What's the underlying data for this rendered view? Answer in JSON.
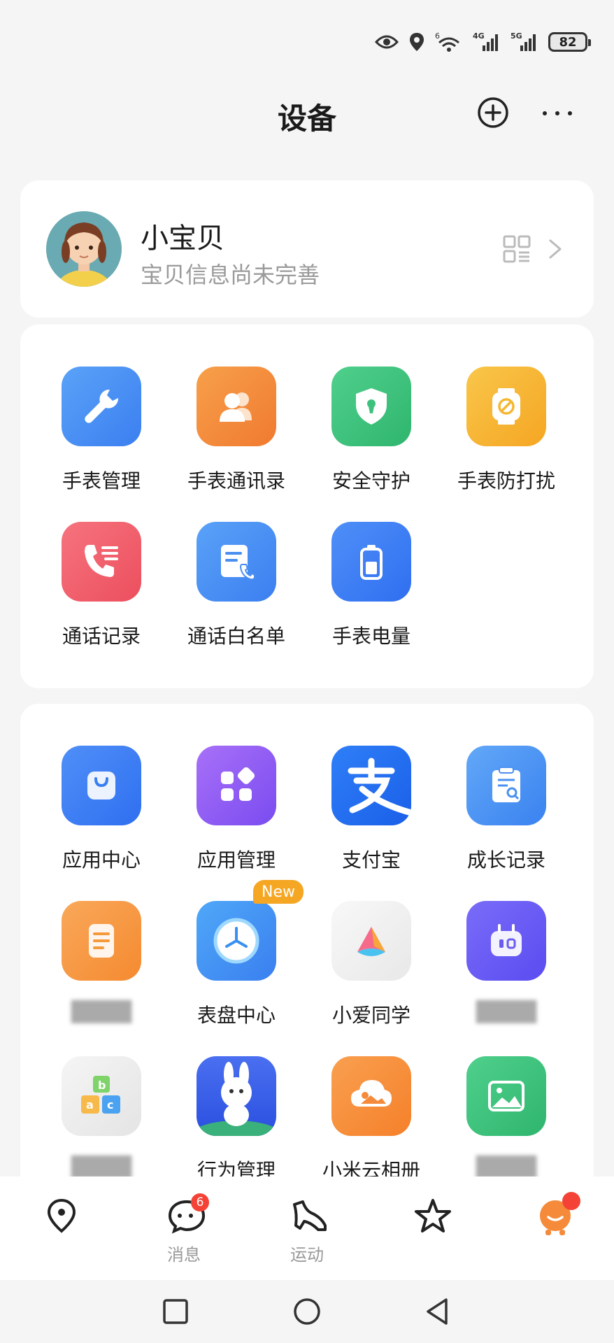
{
  "status_bar": {
    "battery": "82",
    "wifi_label": "6",
    "net1": "4G",
    "net2": "5G"
  },
  "header": {
    "title": "设备"
  },
  "profile": {
    "name": "小宝贝",
    "subtitle": "宝贝信息尚未完善"
  },
  "section1": {
    "items": [
      {
        "label": "手表管理",
        "icon": "wrench-icon",
        "color": "#4a8ff0"
      },
      {
        "label": "手表通讯录",
        "icon": "contacts-icon",
        "color": "#f58a3a"
      },
      {
        "label": "安全守护",
        "icon": "shield-icon",
        "color": "#3cc27d"
      },
      {
        "label": "手表防打扰",
        "icon": "do-not-disturb-watch-icon",
        "color": "#f5b731"
      },
      {
        "label": "通话记录",
        "icon": "call-log-icon",
        "color": "#ef5b6a"
      },
      {
        "label": "通话白名单",
        "icon": "whitelist-icon",
        "color": "#4a8ff0"
      },
      {
        "label": "手表电量",
        "icon": "battery-icon",
        "color": "#3a7ff0"
      }
    ]
  },
  "section2": {
    "items": [
      {
        "label": "应用中心",
        "icon": "app-store-icon",
        "color": "#3a7ff0"
      },
      {
        "label": "应用管理",
        "icon": "app-manage-icon",
        "color": "#8c5cf0"
      },
      {
        "label": "支付宝",
        "icon": "alipay-icon",
        "color": "#1f6ff0"
      },
      {
        "label": "成长记录",
        "icon": "growth-record-icon",
        "color": "#4a90f0"
      },
      {
        "label": "",
        "icon": "document-icon",
        "color": "#f59a3a"
      },
      {
        "label": "表盘中心",
        "icon": "watch-face-icon",
        "color": "#3a90f0",
        "badge": "New"
      },
      {
        "label": "小爱同学",
        "icon": "xiaoai-icon",
        "color": "#f0f0f0"
      },
      {
        "label": "",
        "icon": "robot-icon",
        "color": "#6a5cf0"
      },
      {
        "label": "",
        "icon": "blocks-icon",
        "color": "#ececec"
      },
      {
        "label": "行为管理",
        "icon": "rabbit-icon",
        "color": "#4a6ff0"
      },
      {
        "label": "小米云相册",
        "icon": "cloud-album-icon",
        "color": "#f58a3a"
      },
      {
        "label": "",
        "icon": "photo-icon",
        "color": "#3cc27d"
      }
    ]
  },
  "bottom_nav": {
    "items": [
      {
        "label": "",
        "icon": "location-icon"
      },
      {
        "label": "消息",
        "icon": "message-icon",
        "badge": "6"
      },
      {
        "label": "运动",
        "icon": "sport-shoe-icon"
      },
      {
        "label": "",
        "icon": "star-icon"
      },
      {
        "label": "",
        "icon": "mascot-icon"
      }
    ]
  }
}
